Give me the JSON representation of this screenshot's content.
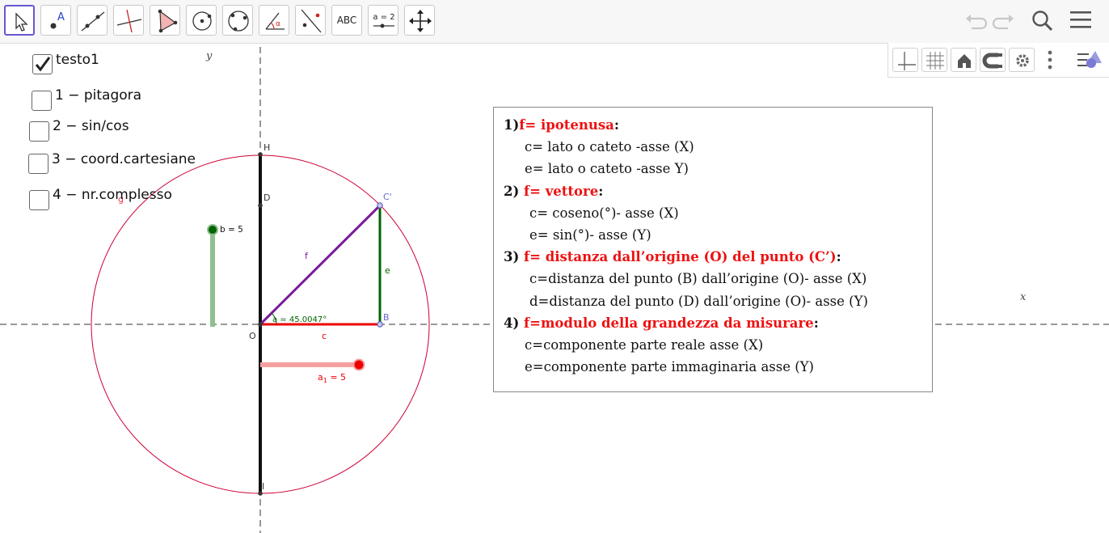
{
  "toolbar": {
    "tools": [
      {
        "id": "move",
        "icon": "move-pointer-icon"
      },
      {
        "id": "point",
        "icon": "point-icon",
        "label": "A"
      },
      {
        "id": "line",
        "icon": "line-icon"
      },
      {
        "id": "perpendicular",
        "icon": "perpendicular-line-icon"
      },
      {
        "id": "polygon",
        "icon": "polygon-icon"
      },
      {
        "id": "circle-center",
        "icon": "circle-center-icon"
      },
      {
        "id": "circle-three",
        "icon": "circle-three-points-icon"
      },
      {
        "id": "angle",
        "icon": "angle-icon",
        "label": "α"
      },
      {
        "id": "reflect",
        "icon": "reflect-icon"
      },
      {
        "id": "text",
        "icon": "text-icon",
        "label": "ABC"
      },
      {
        "id": "slider",
        "icon": "slider-icon",
        "label": "a = 2"
      },
      {
        "id": "move-view",
        "icon": "move-graphics-view-icon"
      }
    ],
    "right": [
      "undo-icon",
      "redo-icon",
      "search-icon",
      "menu-icon"
    ]
  },
  "stylebar": [
    "axes-icon",
    "grid-icon",
    "home-icon",
    "magnet-icon",
    "gear-icon",
    "more-vertical-icon",
    "style-toggle-icon"
  ],
  "checkboxes": [
    {
      "label": "testo1",
      "checked": true
    },
    {
      "label": "1 − pitagora",
      "checked": false
    },
    {
      "label": "2 − sin/cos",
      "checked": false
    },
    {
      "label": "3 − coord.cartesiane",
      "checked": false
    },
    {
      "label": "4 − nr.complesso",
      "checked": false
    }
  ],
  "axes": {
    "x": "x",
    "y": "y"
  },
  "points": {
    "H": "H",
    "D": "D",
    "Cp": "C'",
    "B": "B",
    "O": "O",
    "I": "I"
  },
  "segments": {
    "f": "f",
    "e": "e",
    "c": "c",
    "g": "g"
  },
  "sliders": {
    "b": {
      "label": "b = 5",
      "value": 5,
      "color": "#006400"
    },
    "a1": {
      "label_main": "a",
      "label_sub": "1",
      "label_rest": " = 5",
      "value": 5,
      "color": "#ee0000"
    }
  },
  "angle": {
    "label": "a = 45.0047°"
  },
  "text_box": {
    "lines": [
      {
        "parts": [
          {
            "t": "1)",
            "s": "b"
          },
          {
            "t": "f= ipotenusa",
            "s": "red"
          },
          {
            "t": ":",
            "s": "b"
          }
        ]
      },
      {
        "indent": 1,
        "parts": [
          {
            "t": "c= lato o cateto -asse (X)",
            "s": ""
          }
        ]
      },
      {
        "indent": 1,
        "parts": [
          {
            "t": "e=  lato o cateto -asse Y)",
            "s": ""
          }
        ]
      },
      {
        "parts": [
          {
            "t": "2) ",
            "s": "b"
          },
          {
            "t": "f= vettore",
            "s": "red"
          },
          {
            "t": ":",
            "s": "b"
          }
        ]
      },
      {
        "indent": 2,
        "parts": [
          {
            "t": "c= coseno(°)- asse (X)",
            "s": ""
          }
        ]
      },
      {
        "indent": 2,
        "parts": [
          {
            "t": "e= sin(°)- asse (Y)",
            "s": ""
          }
        ]
      },
      {
        "parts": [
          {
            "t": "3) ",
            "s": "b"
          },
          {
            "t": "f= distanza  dall’origine  (O)  del  punto  (C’)",
            "s": "red"
          },
          {
            "t": ":",
            "s": "b"
          }
        ]
      },
      {
        "indent": 2,
        "parts": [
          {
            "t": "c=distanza del punto (B) dall’origine (O)- asse (X)",
            "s": ""
          }
        ]
      },
      {
        "indent": 2,
        "parts": [
          {
            "t": "d=distanza del punto (D) dall’origine (O)- asse (Y)",
            "s": ""
          }
        ]
      },
      {
        "parts": [
          {
            "t": "4) ",
            "s": "b"
          },
          {
            "t": "f=modulo  della  grandezza  da  misurare",
            "s": "red"
          },
          {
            "t": ":",
            "s": "b"
          }
        ]
      },
      {
        "indent": 1,
        "parts": [
          {
            "t": "c=componente parte reale asse (X)",
            "s": ""
          }
        ]
      },
      {
        "indent": 1,
        "parts": [
          {
            "t": "e=componente parte immaginaria asse (Y)",
            "s": ""
          }
        ]
      }
    ]
  }
}
